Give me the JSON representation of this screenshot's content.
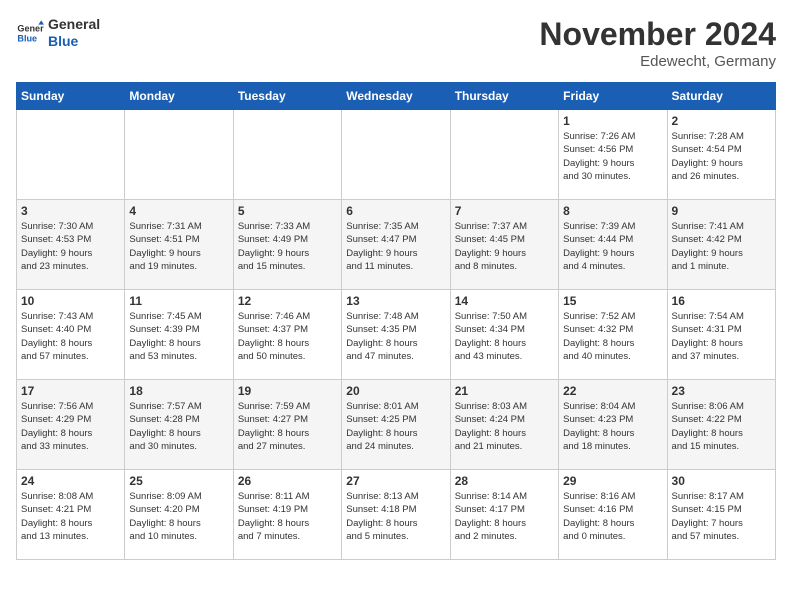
{
  "logo": {
    "line1": "General",
    "line2": "Blue"
  },
  "title": "November 2024",
  "location": "Edewecht, Germany",
  "days_header": [
    "Sunday",
    "Monday",
    "Tuesday",
    "Wednesday",
    "Thursday",
    "Friday",
    "Saturday"
  ],
  "weeks": [
    [
      {
        "day": "",
        "info": ""
      },
      {
        "day": "",
        "info": ""
      },
      {
        "day": "",
        "info": ""
      },
      {
        "day": "",
        "info": ""
      },
      {
        "day": "",
        "info": ""
      },
      {
        "day": "1",
        "info": "Sunrise: 7:26 AM\nSunset: 4:56 PM\nDaylight: 9 hours\nand 30 minutes."
      },
      {
        "day": "2",
        "info": "Sunrise: 7:28 AM\nSunset: 4:54 PM\nDaylight: 9 hours\nand 26 minutes."
      }
    ],
    [
      {
        "day": "3",
        "info": "Sunrise: 7:30 AM\nSunset: 4:53 PM\nDaylight: 9 hours\nand 23 minutes."
      },
      {
        "day": "4",
        "info": "Sunrise: 7:31 AM\nSunset: 4:51 PM\nDaylight: 9 hours\nand 19 minutes."
      },
      {
        "day": "5",
        "info": "Sunrise: 7:33 AM\nSunset: 4:49 PM\nDaylight: 9 hours\nand 15 minutes."
      },
      {
        "day": "6",
        "info": "Sunrise: 7:35 AM\nSunset: 4:47 PM\nDaylight: 9 hours\nand 11 minutes."
      },
      {
        "day": "7",
        "info": "Sunrise: 7:37 AM\nSunset: 4:45 PM\nDaylight: 9 hours\nand 8 minutes."
      },
      {
        "day": "8",
        "info": "Sunrise: 7:39 AM\nSunset: 4:44 PM\nDaylight: 9 hours\nand 4 minutes."
      },
      {
        "day": "9",
        "info": "Sunrise: 7:41 AM\nSunset: 4:42 PM\nDaylight: 9 hours\nand 1 minute."
      }
    ],
    [
      {
        "day": "10",
        "info": "Sunrise: 7:43 AM\nSunset: 4:40 PM\nDaylight: 8 hours\nand 57 minutes."
      },
      {
        "day": "11",
        "info": "Sunrise: 7:45 AM\nSunset: 4:39 PM\nDaylight: 8 hours\nand 53 minutes."
      },
      {
        "day": "12",
        "info": "Sunrise: 7:46 AM\nSunset: 4:37 PM\nDaylight: 8 hours\nand 50 minutes."
      },
      {
        "day": "13",
        "info": "Sunrise: 7:48 AM\nSunset: 4:35 PM\nDaylight: 8 hours\nand 47 minutes."
      },
      {
        "day": "14",
        "info": "Sunrise: 7:50 AM\nSunset: 4:34 PM\nDaylight: 8 hours\nand 43 minutes."
      },
      {
        "day": "15",
        "info": "Sunrise: 7:52 AM\nSunset: 4:32 PM\nDaylight: 8 hours\nand 40 minutes."
      },
      {
        "day": "16",
        "info": "Sunrise: 7:54 AM\nSunset: 4:31 PM\nDaylight: 8 hours\nand 37 minutes."
      }
    ],
    [
      {
        "day": "17",
        "info": "Sunrise: 7:56 AM\nSunset: 4:29 PM\nDaylight: 8 hours\nand 33 minutes."
      },
      {
        "day": "18",
        "info": "Sunrise: 7:57 AM\nSunset: 4:28 PM\nDaylight: 8 hours\nand 30 minutes."
      },
      {
        "day": "19",
        "info": "Sunrise: 7:59 AM\nSunset: 4:27 PM\nDaylight: 8 hours\nand 27 minutes."
      },
      {
        "day": "20",
        "info": "Sunrise: 8:01 AM\nSunset: 4:25 PM\nDaylight: 8 hours\nand 24 minutes."
      },
      {
        "day": "21",
        "info": "Sunrise: 8:03 AM\nSunset: 4:24 PM\nDaylight: 8 hours\nand 21 minutes."
      },
      {
        "day": "22",
        "info": "Sunrise: 8:04 AM\nSunset: 4:23 PM\nDaylight: 8 hours\nand 18 minutes."
      },
      {
        "day": "23",
        "info": "Sunrise: 8:06 AM\nSunset: 4:22 PM\nDaylight: 8 hours\nand 15 minutes."
      }
    ],
    [
      {
        "day": "24",
        "info": "Sunrise: 8:08 AM\nSunset: 4:21 PM\nDaylight: 8 hours\nand 13 minutes."
      },
      {
        "day": "25",
        "info": "Sunrise: 8:09 AM\nSunset: 4:20 PM\nDaylight: 8 hours\nand 10 minutes."
      },
      {
        "day": "26",
        "info": "Sunrise: 8:11 AM\nSunset: 4:19 PM\nDaylight: 8 hours\nand 7 minutes."
      },
      {
        "day": "27",
        "info": "Sunrise: 8:13 AM\nSunset: 4:18 PM\nDaylight: 8 hours\nand 5 minutes."
      },
      {
        "day": "28",
        "info": "Sunrise: 8:14 AM\nSunset: 4:17 PM\nDaylight: 8 hours\nand 2 minutes."
      },
      {
        "day": "29",
        "info": "Sunrise: 8:16 AM\nSunset: 4:16 PM\nDaylight: 8 hours\nand 0 minutes."
      },
      {
        "day": "30",
        "info": "Sunrise: 8:17 AM\nSunset: 4:15 PM\nDaylight: 7 hours\nand 57 minutes."
      }
    ]
  ]
}
